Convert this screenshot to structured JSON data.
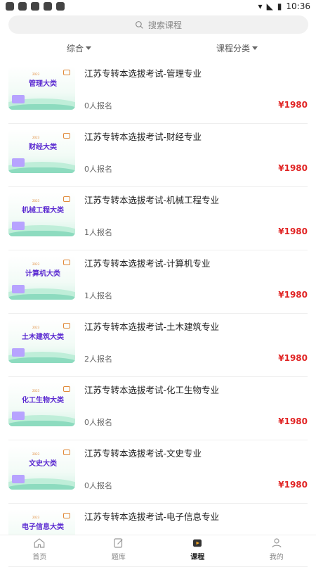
{
  "status": {
    "time": "10:36"
  },
  "search": {
    "placeholder": "搜索课程"
  },
  "filters": [
    {
      "label": "综合"
    },
    {
      "label": "课程分类"
    }
  ],
  "courses": [
    {
      "thumb": "管理大类",
      "title": "江苏专转本选拔考试-管理专业",
      "enroll": "0人报名",
      "price": "¥1980"
    },
    {
      "thumb": "财经大类",
      "title": "江苏专转本选拔考试-财经专业",
      "enroll": "0人报名",
      "price": "¥1980"
    },
    {
      "thumb": "机械工程大类",
      "title": "江苏专转本选拔考试-机械工程专业",
      "enroll": "1人报名",
      "price": "¥1980"
    },
    {
      "thumb": "计算机大类",
      "title": "江苏专转本选拔考试-计算机专业",
      "enroll": "1人报名",
      "price": "¥1980"
    },
    {
      "thumb": "土木建筑大类",
      "title": "江苏专转本选拔考试-土木建筑专业",
      "enroll": "2人报名",
      "price": "¥1980"
    },
    {
      "thumb": "化工生物大类",
      "title": "江苏专转本选拔考试-化工生物专业",
      "enroll": "0人报名",
      "price": "¥1980"
    },
    {
      "thumb": "文史大类",
      "title": "江苏专转本选拔考试-文史专业",
      "enroll": "0人报名",
      "price": "¥1980"
    },
    {
      "thumb": "电子信息大类",
      "title": "江苏专转本选拔考试-电子信息专业",
      "enroll": "",
      "price": ""
    }
  ],
  "tabbar": [
    {
      "label": "首页",
      "icon": "home-icon"
    },
    {
      "label": "题库",
      "icon": "edit-icon"
    },
    {
      "label": "课程",
      "icon": "course-icon",
      "active": true
    },
    {
      "label": "我的",
      "icon": "user-icon"
    }
  ]
}
